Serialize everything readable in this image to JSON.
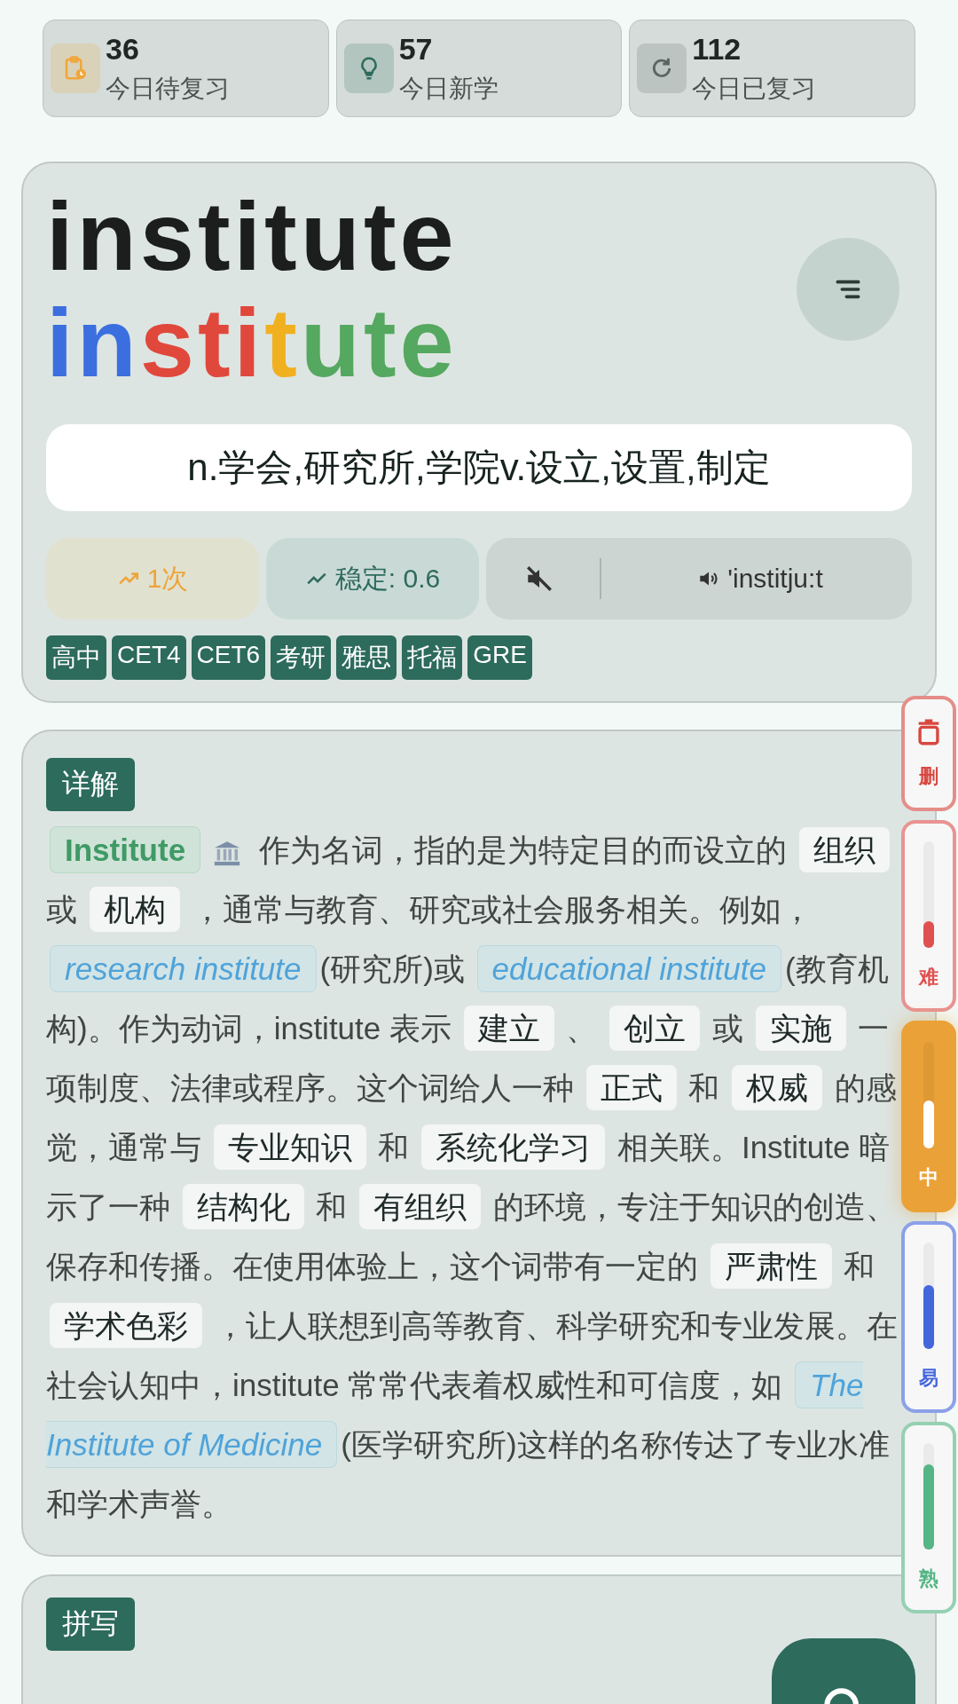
{
  "stats": [
    {
      "kind": "due",
      "value": "36",
      "label": "今日待复习",
      "color": "#f0a63a"
    },
    {
      "kind": "new",
      "value": "57",
      "label": "今日新学",
      "color": "#2e6b5c"
    },
    {
      "kind": "done",
      "value": "112",
      "label": "今日已复习",
      "color": "#5b6663"
    }
  ],
  "word": {
    "text": "institute",
    "syllables": [
      {
        "text": "in",
        "color": "#3b6fe0"
      },
      {
        "text": "sti",
        "color": "#e0483c"
      },
      {
        "text": "t",
        "color": "#f0b020"
      },
      {
        "text": "ute",
        "color": "#55a85f"
      }
    ],
    "meaning": "n.学会,研究所,学院v.设立,设置,制定",
    "count": "1次",
    "stability": "稳定: 0.6",
    "muted": true,
    "phonetic": "'institju:t",
    "tags": [
      "高中",
      "CET4",
      "CET6",
      "考研",
      "雅思",
      "托福",
      "GRE"
    ]
  },
  "detail": {
    "title": "详解",
    "segments": [
      {
        "kind": "head",
        "text": "Institute"
      },
      {
        "kind": "icon"
      },
      {
        "kind": "text",
        "text": " 作为名词，指的是为特定目的而设立的 "
      },
      {
        "kind": "key",
        "text": "组织"
      },
      {
        "kind": "text",
        "text": " 或 "
      },
      {
        "kind": "key",
        "text": "机构"
      },
      {
        "kind": "text",
        "text": " ，通常与教育、研究或社会服务相关。例如，"
      },
      {
        "kind": "example",
        "text": "research institute"
      },
      {
        "kind": "text",
        "text": "(研究所)或 "
      },
      {
        "kind": "example",
        "text": "educational institute"
      },
      {
        "kind": "text",
        "text": "(教育机构)。作为动词，institute 表示 "
      },
      {
        "kind": "key",
        "text": "建立"
      },
      {
        "kind": "text",
        "text": " 、 "
      },
      {
        "kind": "key",
        "text": "创立"
      },
      {
        "kind": "text",
        "text": " 或 "
      },
      {
        "kind": "key",
        "text": "实施"
      },
      {
        "kind": "text",
        "text": " 一项制度、法律或程序。这个词给人一种 "
      },
      {
        "kind": "key",
        "text": "正式"
      },
      {
        "kind": "text",
        "text": " 和 "
      },
      {
        "kind": "key",
        "text": "权威"
      },
      {
        "kind": "text",
        "text": " 的感觉，通常与 "
      },
      {
        "kind": "key",
        "text": "专业知识"
      },
      {
        "kind": "text",
        "text": " 和 "
      },
      {
        "kind": "key",
        "text": "系统化学习"
      },
      {
        "kind": "text",
        "text": " 相关联。Institute 暗示了一种 "
      },
      {
        "kind": "key",
        "text": "结构化"
      },
      {
        "kind": "text",
        "text": " 和 "
      },
      {
        "kind": "key",
        "text": "有组织"
      },
      {
        "kind": "text",
        "text": " 的环境，专注于知识的创造、保存和传播。在使用体验上，这个词带有一定的 "
      },
      {
        "kind": "key",
        "text": "严肃性"
      },
      {
        "kind": "text",
        "text": " 和 "
      },
      {
        "kind": "key",
        "text": "学术色彩"
      },
      {
        "kind": "text",
        "text": " ，让人联想到高等教育、科学研究和专业发展。在社会认知中，institute 常常代表着权威性和可信度，如 "
      },
      {
        "kind": "example",
        "text": "The Institute of Medicine"
      },
      {
        "kind": "text",
        "text": "(医学研究所)这样的名称传达了专业水准和学术声誉。"
      }
    ]
  },
  "spelling": {
    "title": "拼写"
  },
  "side_buttons": [
    {
      "kind": "delete",
      "label": "删",
      "color": "#d9473f",
      "selected": false
    },
    {
      "kind": "rate",
      "label": "难",
      "color": "#e05050",
      "selected": false,
      "level": 0.25
    },
    {
      "kind": "rate",
      "label": "中",
      "color": "#eaa238",
      "selected": true,
      "level": 0.45
    },
    {
      "kind": "rate",
      "label": "易",
      "color": "#4466dd",
      "selected": false,
      "level": 0.6
    },
    {
      "kind": "rate",
      "label": "熟",
      "color": "#55b585",
      "selected": false,
      "level": 0.8
    }
  ]
}
